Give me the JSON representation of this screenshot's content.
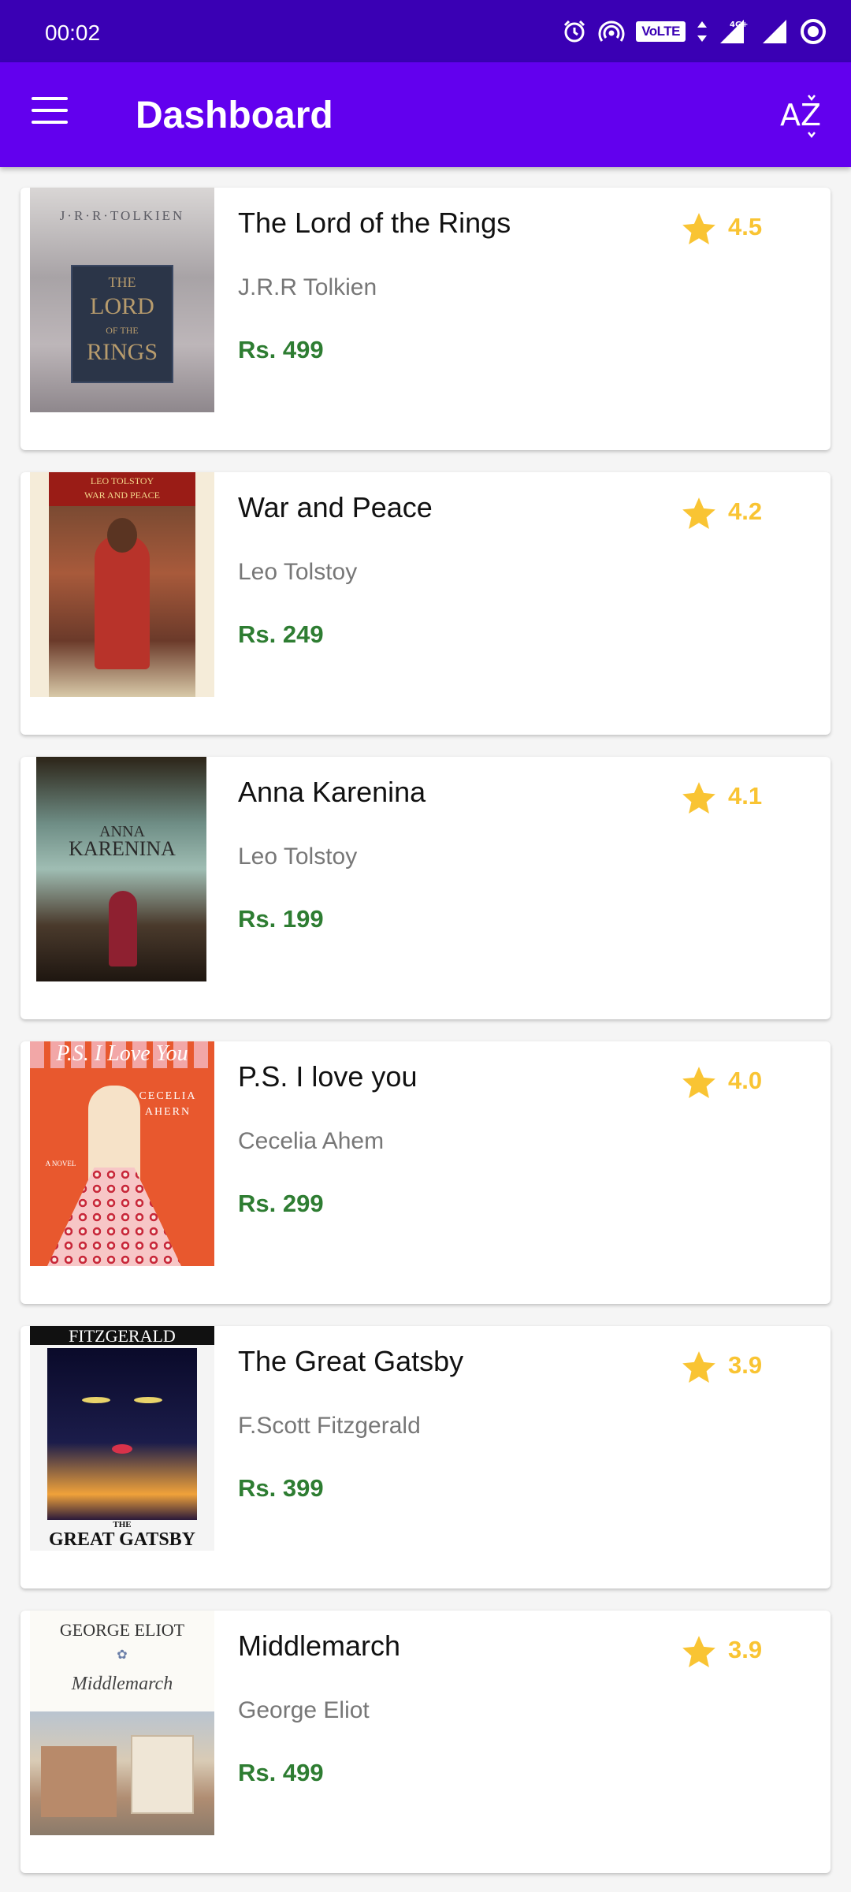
{
  "status_bar": {
    "time": "00:02",
    "volte": "VoLTE",
    "network": "4G+"
  },
  "app_bar": {
    "title": "Dashboard",
    "menu_icon": "hamburger-menu-icon",
    "sort_icon": "sort-az-icon",
    "background_color": "#6200ee"
  },
  "colors": {
    "price": "#2e7d32",
    "rating": "#f9c433",
    "status_bar": "#3a00b4"
  },
  "books": [
    {
      "title": "The Lord of the Rings",
      "author": "J.R.R Tolkien",
      "price": "Rs. 499",
      "rating": "4.5",
      "cover": {
        "top": "J·R·R·TOLKIEN",
        "l1": "THE",
        "l2": "LORD",
        "l3": "OF THE",
        "l4": "RINGS"
      }
    },
    {
      "title": "War and Peace",
      "author": "Leo Tolstoy",
      "price": "Rs. 249",
      "rating": "4.2",
      "cover": {
        "l1": "LEO TOLSTOY",
        "l2": "WAR AND PEACE"
      }
    },
    {
      "title": "Anna Karenina",
      "author": "Leo Tolstoy",
      "price": "Rs. 199",
      "rating": "4.1",
      "cover": {
        "l1": "ANNA",
        "l2": "KARENINA"
      }
    },
    {
      "title": "P.S. I love you",
      "author": "Cecelia Ahem",
      "price": "Rs. 299",
      "rating": "4.0",
      "cover": {
        "l1": "P.S. I Love You",
        "l2": "CECELIA",
        "l3": "AHERN",
        "l4": "A NOVEL"
      }
    },
    {
      "title": "The Great Gatsby",
      "author": "F.Scott Fitzgerald",
      "price": "Rs. 399",
      "rating": "3.9",
      "cover": {
        "l1": "FITZGERALD",
        "l2": "THE",
        "l3": "GREAT GATSBY"
      }
    },
    {
      "title": "Middlemarch",
      "author": "George Eliot",
      "price": "Rs. 499",
      "rating": "3.9",
      "cover": {
        "l1": "GEORGE ELIOT",
        "l2": "Middlemarch"
      }
    }
  ]
}
